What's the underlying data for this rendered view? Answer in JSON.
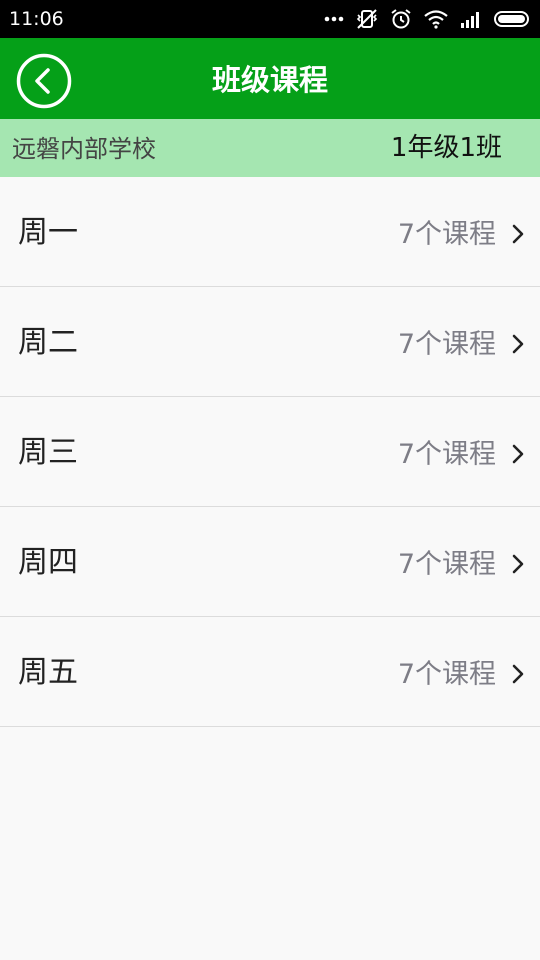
{
  "status_bar": {
    "time": "11:06",
    "icons": [
      "more-dots-icon",
      "vibrate-off-icon",
      "alarm-icon",
      "wifi-icon",
      "signal-icon",
      "battery-icon"
    ]
  },
  "header": {
    "title": "班级课程",
    "back_icon": "chevron-left-circle-icon",
    "background_color": "#05a018"
  },
  "info_bar": {
    "school": "远磐内部学校",
    "class_name": "1年级1班",
    "background_color": "#a5e6b1"
  },
  "days": [
    {
      "label": "周一",
      "count": "7个课程"
    },
    {
      "label": "周二",
      "count": "7个课程"
    },
    {
      "label": "周三",
      "count": "7个课程"
    },
    {
      "label": "周四",
      "count": "7个课程"
    },
    {
      "label": "周五",
      "count": "7个课程"
    }
  ]
}
